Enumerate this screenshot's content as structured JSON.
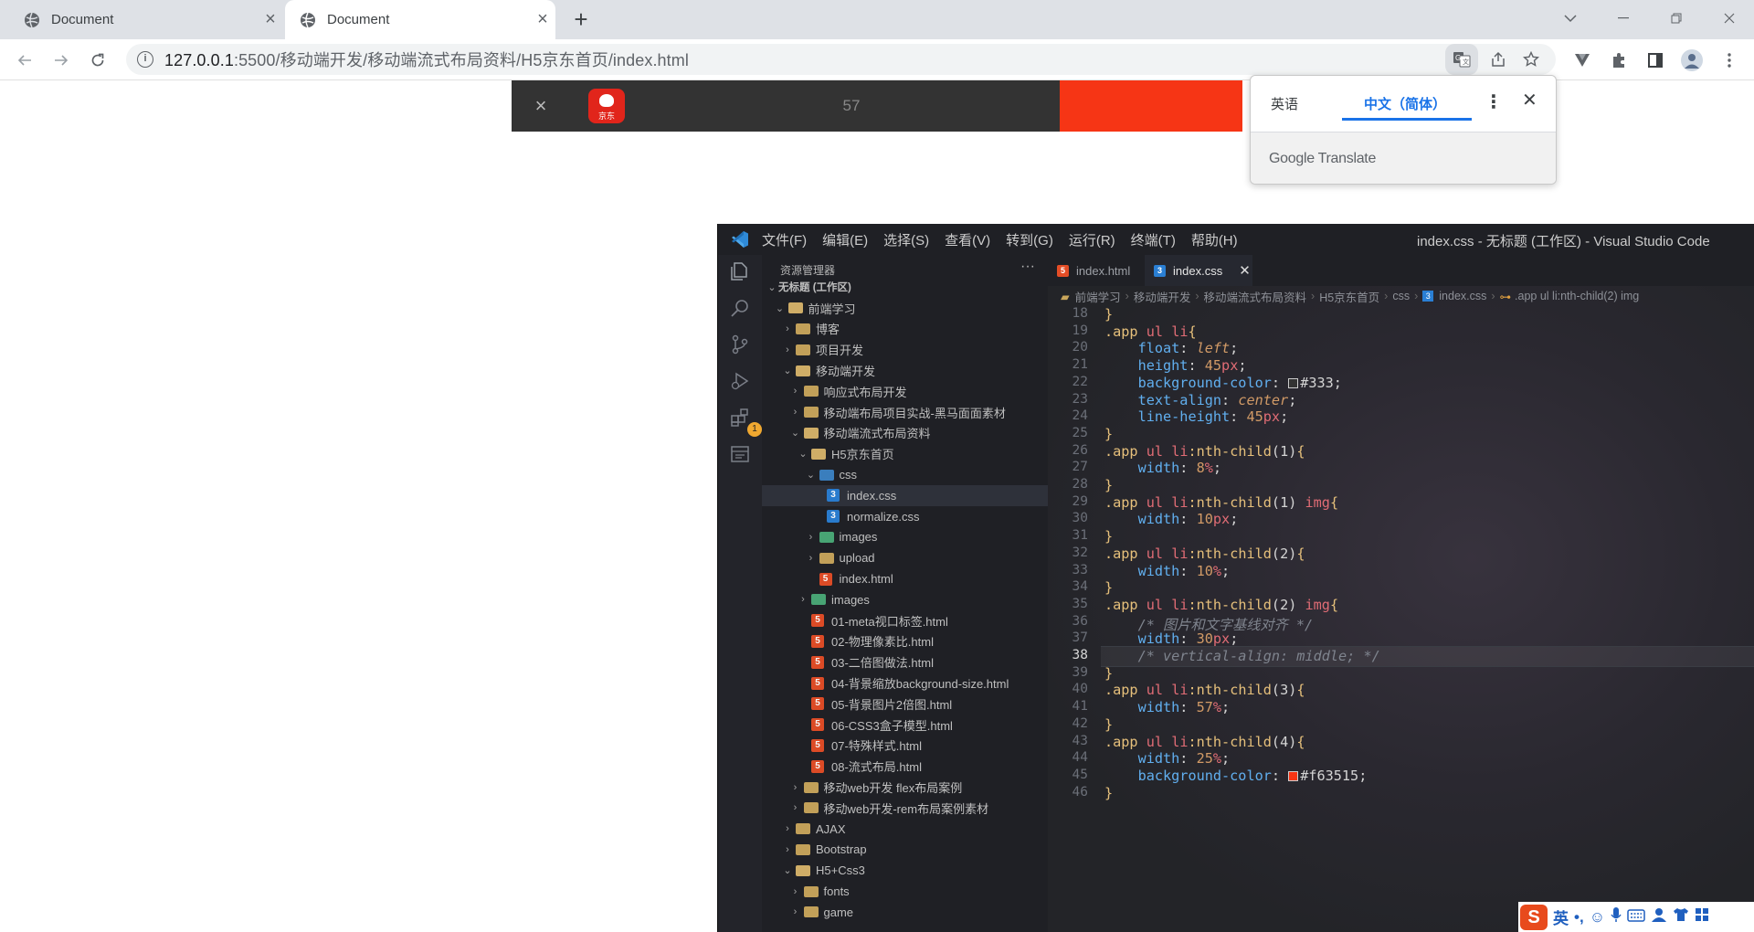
{
  "browser": {
    "tabs": [
      {
        "title": "Document",
        "active": false
      },
      {
        "title": "Document",
        "active": true
      }
    ],
    "url_host": "127.0.0.1",
    "url_rest": ":5500/移动端开发/移动端流式布局资料/H5京东首页/index.html"
  },
  "page": {
    "close_label": "×",
    "logo_text": "京东",
    "middle_text": "57",
    "colors": {
      "bar_bg": "#333333",
      "accent": "#f63515"
    }
  },
  "translate": {
    "lang_en": "英语",
    "lang_zh": "中文（简体）",
    "brand": "Google Translate"
  },
  "vscode": {
    "menu": [
      "文件(F)",
      "编辑(E)",
      "选择(S)",
      "查看(V)",
      "转到(G)",
      "运行(R)",
      "终端(T)",
      "帮助(H)"
    ],
    "window_title": "index.css - 无标题 (工作区) - Visual Studio Code",
    "explorer_title": "资源管理器",
    "tree": [
      {
        "label": "无标题 (工作区)",
        "depth": 0,
        "kind": "root",
        "open": true
      },
      {
        "label": "前端学习",
        "depth": 1,
        "kind": "folder",
        "open": true
      },
      {
        "label": "博客",
        "depth": 2,
        "kind": "folder",
        "open": false
      },
      {
        "label": "项目开发",
        "depth": 2,
        "kind": "folder",
        "open": false
      },
      {
        "label": "移动端开发",
        "depth": 2,
        "kind": "folder",
        "open": true
      },
      {
        "label": "响应式布局开发",
        "depth": 3,
        "kind": "folder",
        "open": false
      },
      {
        "label": "移动端布局项目实战-黑马面面素材",
        "depth": 3,
        "kind": "folder",
        "open": false
      },
      {
        "label": "移动端流式布局资料",
        "depth": 3,
        "kind": "folder",
        "open": true
      },
      {
        "label": "H5京东首页",
        "depth": 4,
        "kind": "folder",
        "open": true
      },
      {
        "label": "css",
        "depth": 5,
        "kind": "cssfolder",
        "open": true
      },
      {
        "label": "index.css",
        "depth": 6,
        "kind": "css",
        "selected": true
      },
      {
        "label": "normalize.css",
        "depth": 6,
        "kind": "css"
      },
      {
        "label": "images",
        "depth": 5,
        "kind": "imgfolder",
        "open": false
      },
      {
        "label": "upload",
        "depth": 5,
        "kind": "folder",
        "open": false
      },
      {
        "label": "index.html",
        "depth": 5,
        "kind": "html"
      },
      {
        "label": "images",
        "depth": 4,
        "kind": "imgfolder",
        "open": false
      },
      {
        "label": "01-meta视口标签.html",
        "depth": 4,
        "kind": "html"
      },
      {
        "label": "02-物理像素比.html",
        "depth": 4,
        "kind": "html"
      },
      {
        "label": "03-二倍图做法.html",
        "depth": 4,
        "kind": "html"
      },
      {
        "label": "04-背景缩放background-size.html",
        "depth": 4,
        "kind": "html"
      },
      {
        "label": "05-背景图片2倍图.html",
        "depth": 4,
        "kind": "html"
      },
      {
        "label": "06-CSS3盒子模型.html",
        "depth": 4,
        "kind": "html"
      },
      {
        "label": "07-特殊样式.html",
        "depth": 4,
        "kind": "html"
      },
      {
        "label": "08-流式布局.html",
        "depth": 4,
        "kind": "html"
      },
      {
        "label": "移动web开发 flex布局案例",
        "depth": 3,
        "kind": "folder",
        "open": false
      },
      {
        "label": "移动web开发-rem布局案例素材",
        "depth": 3,
        "kind": "folder",
        "open": false
      },
      {
        "label": "AJAX",
        "depth": 2,
        "kind": "folder",
        "open": false
      },
      {
        "label": "Bootstrap",
        "depth": 2,
        "kind": "folder",
        "open": false
      },
      {
        "label": "H5+Css3",
        "depth": 2,
        "kind": "folder",
        "open": true
      },
      {
        "label": "fonts",
        "depth": 3,
        "kind": "folder",
        "open": false
      },
      {
        "label": "game",
        "depth": 3,
        "kind": "folder",
        "open": false
      }
    ],
    "tabs": [
      {
        "label": "index.html",
        "kind": "html",
        "active": false
      },
      {
        "label": "index.css",
        "kind": "css",
        "active": true
      }
    ],
    "breadcrumbs": [
      "前端学习",
      "移动端开发",
      "移动端流式布局资料",
      "H5京东首页",
      "css",
      "index.css",
      ".app ul li:nth-child(2) img"
    ],
    "current_line": 38,
    "code": [
      {
        "n": 18,
        "t": "}"
      },
      {
        "n": 19,
        "t": ".app ul li{"
      },
      {
        "n": 20,
        "t": "    float: left;"
      },
      {
        "n": 21,
        "t": "    height: 45px;"
      },
      {
        "n": 22,
        "t": "    background-color: #333;"
      },
      {
        "n": 23,
        "t": "    text-align: center;"
      },
      {
        "n": 24,
        "t": "    line-height: 45px;"
      },
      {
        "n": 25,
        "t": "}"
      },
      {
        "n": 26,
        "t": ".app ul li:nth-child(1){"
      },
      {
        "n": 27,
        "t": "    width: 8%;"
      },
      {
        "n": 28,
        "t": "}"
      },
      {
        "n": 29,
        "t": ".app ul li:nth-child(1) img{"
      },
      {
        "n": 30,
        "t": "    width: 10px;"
      },
      {
        "n": 31,
        "t": "}"
      },
      {
        "n": 32,
        "t": ".app ul li:nth-child(2){"
      },
      {
        "n": 33,
        "t": "    width: 10%;"
      },
      {
        "n": 34,
        "t": "}"
      },
      {
        "n": 35,
        "t": ".app ul li:nth-child(2) img{"
      },
      {
        "n": 36,
        "t": "    /* 图片和文字基线对齐 */"
      },
      {
        "n": 37,
        "t": "    width: 30px;"
      },
      {
        "n": 38,
        "t": "    /* vertical-align: middle; */"
      },
      {
        "n": 39,
        "t": "}"
      },
      {
        "n": 40,
        "t": ".app ul li:nth-child(3){"
      },
      {
        "n": 41,
        "t": "    width: 57%;"
      },
      {
        "n": 42,
        "t": "}"
      },
      {
        "n": 43,
        "t": ".app ul li:nth-child(4){"
      },
      {
        "n": 44,
        "t": "    width: 25%;"
      },
      {
        "n": 45,
        "t": "    background-color: #f63515;"
      },
      {
        "n": 46,
        "t": "}"
      }
    ]
  },
  "ime": {
    "logo": "S",
    "mode": "英"
  }
}
